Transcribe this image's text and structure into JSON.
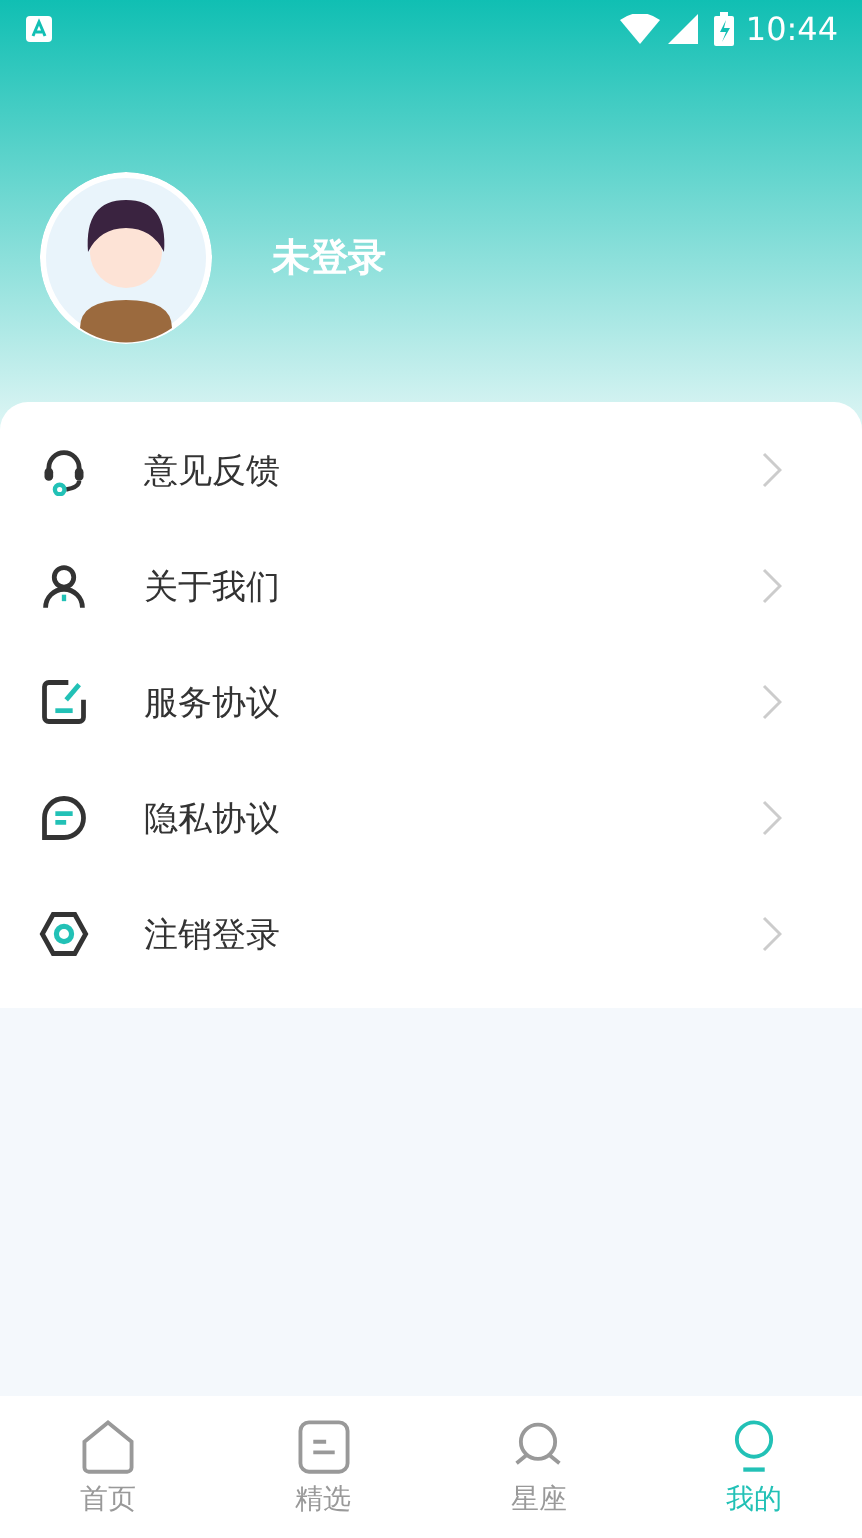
{
  "status_bar": {
    "time": "10:44"
  },
  "profile": {
    "name": "未登录"
  },
  "menu": [
    {
      "label": "意见反馈"
    },
    {
      "label": "关于我们"
    },
    {
      "label": "服务协议"
    },
    {
      "label": "隐私协议"
    },
    {
      "label": "注销登录"
    }
  ],
  "tabs": [
    {
      "label": "首页",
      "selected": false
    },
    {
      "label": "精选",
      "selected": false
    },
    {
      "label": "星座",
      "selected": false
    },
    {
      "label": "我的",
      "selected": true
    }
  ]
}
